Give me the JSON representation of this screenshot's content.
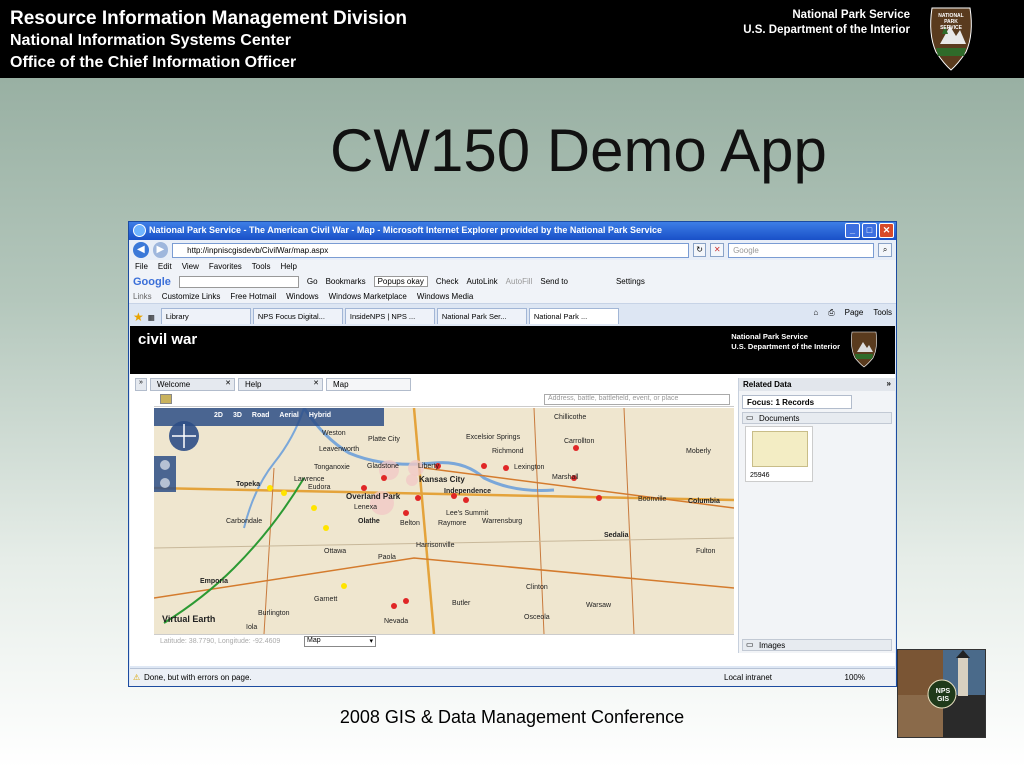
{
  "header": {
    "line1": "Resource Information Management Division",
    "line2": "National Information Systems Center",
    "line3": "Office of the Chief Information Officer",
    "agency_line1": "National Park Service",
    "agency_line2": "U.S. Department of the Interior",
    "badge_text": "NATIONAL PARK SERVICE"
  },
  "title": "CW150 Demo App",
  "browser": {
    "window_title": "National Park Service - The American Civil War - Map - Microsoft Internet Explorer provided by the National Park Service",
    "address": "http://inpniscgisdevb/CivilWar/map.aspx",
    "search_placeholder": "Google",
    "menu": [
      "File",
      "Edit",
      "View",
      "Favorites",
      "Tools",
      "Help"
    ],
    "google_bar": [
      "Google",
      "Go",
      "Bookmarks",
      "Popups okay",
      "Check",
      "AutoLink",
      "AutoFill",
      "Send to",
      "Settings"
    ],
    "links": [
      "Links",
      "Customize Links",
      "Free Hotmail",
      "Windows",
      "Windows Marketplace",
      "Windows Media"
    ],
    "tabs": [
      "Library",
      "NPS Focus Digital...",
      "InsideNPS | NPS ...",
      "National Park Ser...",
      "National Park ..."
    ],
    "tab_tools": [
      "Page",
      "Tools"
    ],
    "status": "Done, but with errors on page.",
    "zone": "Local intranet",
    "zoom": "100%"
  },
  "app": {
    "logo": "civil war",
    "agency_line1": "National Park Service",
    "agency_line2": "U.S. Department of the Interior",
    "tabs": [
      "Welcome",
      "Help",
      "Map"
    ],
    "map_search_placeholder": "Address, battle, battlefield, event, or place",
    "map_modes": [
      "2D",
      "3D",
      "Road",
      "Aerial",
      "Hybrid"
    ],
    "coords": "Latitude: 38.7790, Longitude: -92.4609",
    "layer_select": "Map",
    "map_labels": [
      "Weston",
      "Platte City",
      "Leavenworth",
      "Gladstone",
      "Liberty",
      "Kansas City",
      "Independence",
      "Overland Park",
      "Lenexa",
      "Olathe",
      "Belton",
      "Raymore",
      "Lee's Summit",
      "Harrisonville",
      "Topeka",
      "Lawrence",
      "Ottawa",
      "Emporia",
      "Paola",
      "Butler",
      "Sedalia",
      "Warsaw",
      "Richmond",
      "Lexington",
      "Marshall",
      "Boonville",
      "Columbia",
      "Clinton",
      "Osceola",
      "Carbondale",
      "Burlington",
      "Tonganoxie",
      "Eudora",
      "Garnett",
      "Iola",
      "Fulton",
      "Chillicothe",
      "Carrollton",
      "Moberly",
      "Excelsior Springs",
      "Warrensburg",
      "Nevada",
      "Virtual Earth"
    ],
    "related_title": "Related Data",
    "focus": "Focus: 1 Records",
    "documents": "Documents",
    "doc_id": "25946",
    "images": "Images"
  },
  "footer": "2008 GIS & Data Management Conference",
  "photo_badge": "NPS GIS"
}
